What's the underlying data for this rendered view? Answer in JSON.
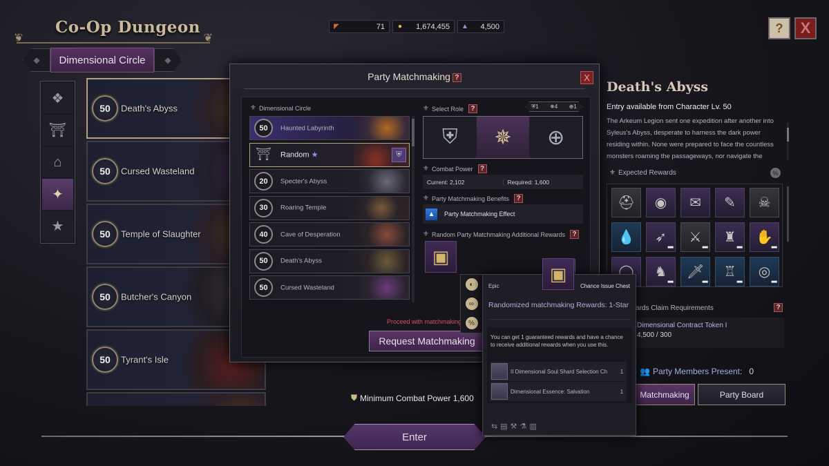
{
  "header": {
    "title": "Co-Op Dungeon",
    "mode": "Dimensional Circle",
    "currencies": [
      {
        "icon": "ticket-icon",
        "value": "71"
      },
      {
        "icon": "gold-coin-icon",
        "value": "1,674,455"
      },
      {
        "icon": "contract-token-icon",
        "value": "4,500"
      }
    ],
    "help_label": "?",
    "close_label": "X"
  },
  "side_tabs": [
    {
      "icon": "diamond-grid-icon",
      "active": false
    },
    {
      "icon": "gate-calendar-icon",
      "active": false
    },
    {
      "icon": "gate-icon",
      "active": false
    },
    {
      "icon": "gate-sparkle-icon",
      "active": true
    },
    {
      "icon": "star-icon",
      "active": false
    }
  ],
  "dungeons": [
    {
      "level": "50",
      "name": "Death's Abyss",
      "selected": true
    },
    {
      "level": "50",
      "name": "Cursed Wasteland",
      "selected": false
    },
    {
      "level": "50",
      "name": "Temple of Slaughter",
      "selected": false
    },
    {
      "level": "50",
      "name": "Butcher's Canyon",
      "selected": false
    },
    {
      "level": "50",
      "name": "Tyrant's Isle",
      "selected": false
    }
  ],
  "modal": {
    "title": "Party Matchmaking",
    "help": "?",
    "close": "X",
    "circle_label": "Dimensional Circle",
    "circles": [
      {
        "level": "50",
        "name": "Haunted Labyrinth",
        "type": "event"
      },
      {
        "level": "",
        "name": "Random",
        "type": "random",
        "star": "★",
        "tag": "⛨"
      },
      {
        "level": "20",
        "name": "Specter's Abyss",
        "type": "normal"
      },
      {
        "level": "30",
        "name": "Roaring Temple",
        "type": "normal"
      },
      {
        "level": "40",
        "name": "Cave of Desperation",
        "type": "normal"
      },
      {
        "level": "50",
        "name": "Death's Abyss",
        "type": "normal"
      },
      {
        "level": "50",
        "name": "Cursed Wasteland",
        "type": "normal"
      }
    ],
    "role_label": "Select Role",
    "role_counts": {
      "tank": "1",
      "dps": "4",
      "healer": "1"
    },
    "roles": [
      {
        "name": "tank",
        "icon": "shield-icon",
        "active": false
      },
      {
        "name": "dps",
        "icon": "crossed-swords-icon",
        "active": true
      },
      {
        "name": "healer",
        "icon": "cross-icon",
        "active": false
      }
    ],
    "combat_power_label": "Combat Power",
    "current_cp": "Current: 2,102",
    "required_cp": "Required: 1,600",
    "benefits_label": "Party Matchmaking Benefits",
    "benefit_effect": "Party Matchmaking Effect",
    "additional_rewards_label": "Random Party Matchmaking Additional Rewards",
    "proceed_text": "Proceed with matchmaking?",
    "request_button": "Request Matchmaking"
  },
  "tooltip": {
    "grade": "Epic",
    "type": "Chance Issue Chest",
    "name": "Randomized matchmaking Rewards: 1-Star",
    "description": "You can get 1 guaranteed rewards and have a chance to receive additional rewards when you use this.",
    "items": [
      {
        "name": "II Dimensional Soul Shard Selection Ch",
        "qty": "1"
      },
      {
        "name": "Dimensional Essence: Salvation",
        "qty": "1"
      }
    ],
    "side_icons": [
      "mouse-icon",
      "link-icon",
      "percent-icon"
    ]
  },
  "detail": {
    "title": "Death's Abyss",
    "entry": "Entry available from Character Lv. 50",
    "description": "The Arkeum Legion sent one expedition after another into Syleus's Abyss, desperate to harness the dark power residing within. None were prepared to face the countless monsters roaming the passageways, nor navigate the",
    "expected_rewards_label": "Expected Rewards",
    "rewards": [
      {
        "icon": "helmet-icon",
        "tone": "gray",
        "dots": false
      },
      {
        "icon": "portrait-coin-icon",
        "tone": "purple",
        "dots": false
      },
      {
        "icon": "scroll-icon",
        "tone": "purple",
        "dots": false
      },
      {
        "icon": "golden-scroll-icon",
        "tone": "purple",
        "dots": false
      },
      {
        "icon": "skull-coin-icon",
        "tone": "gray",
        "dots": false
      },
      {
        "icon": "water-drop-icon",
        "tone": "blue",
        "dots": false
      },
      {
        "icon": "bow-icon",
        "tone": "purple",
        "dots": true
      },
      {
        "icon": "gauntlet-sword-icon",
        "tone": "gray",
        "dots": true
      },
      {
        "icon": "armor-icon",
        "tone": "purple",
        "dots": true
      },
      {
        "icon": "gloves-icon",
        "tone": "purple",
        "dots": true
      },
      {
        "icon": "ring-icon",
        "tone": "purple",
        "dots": false
      },
      {
        "icon": "boots-icon",
        "tone": "purple",
        "dots": true
      },
      {
        "icon": "greatsword-icon",
        "tone": "blue",
        "dots": true
      },
      {
        "icon": "chest-armor-icon",
        "tone": "blue",
        "dots": true
      },
      {
        "icon": "bracelet-icon",
        "tone": "blue",
        "dots": true
      }
    ],
    "claim_label": "Rewards Claim Requirements",
    "claim_item": "Dimensional Contract Token I",
    "claim_value": "4,500 / 300",
    "party_present_label": "Party Members Present:",
    "party_present_value": "0",
    "matchmaking_button": "Matchmaking",
    "party_board_button": "Party Board"
  },
  "footer": {
    "min_cp": "Minimum Combat Power 1,600",
    "enter_button": "Enter"
  }
}
